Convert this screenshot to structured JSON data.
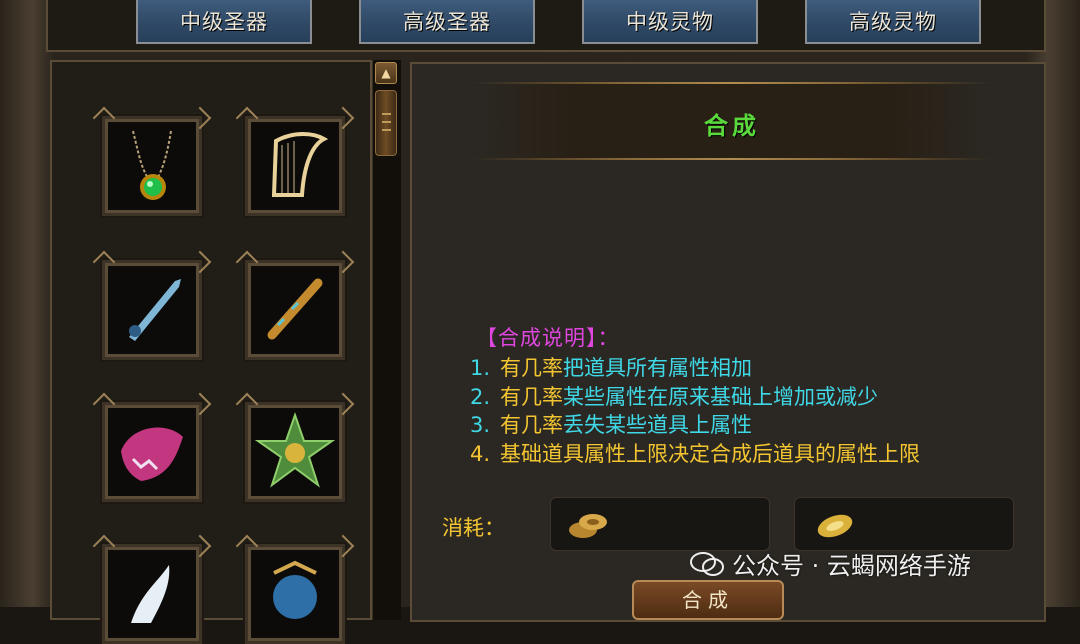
{
  "tabs": [
    {
      "label": "中级圣器"
    },
    {
      "label": "高级圣器"
    },
    {
      "label": "中级灵物"
    },
    {
      "label": "高级灵物"
    }
  ],
  "item_grid": {
    "items": [
      {
        "icon": "necklace-icon"
      },
      {
        "icon": "harp-icon"
      },
      {
        "icon": "sword-icon"
      },
      {
        "icon": "flute-icon"
      },
      {
        "icon": "beast-head-icon"
      },
      {
        "icon": "star-medal-icon"
      },
      {
        "icon": "spirit-icon"
      },
      {
        "icon": "crest-icon"
      }
    ]
  },
  "synthesis": {
    "title": "合成",
    "desc_header": "【合成说明】：",
    "rules": [
      {
        "num": "1.",
        "prefix": "有几率",
        "text": "把道具所有属性相加",
        "color": "#3fd8e6"
      },
      {
        "num": "2.",
        "prefix": "有几率",
        "text": "某些属性在原来基础上增加或减少",
        "color": "#3fd8e6"
      },
      {
        "num": "3.",
        "prefix": "有几率",
        "text": "丢失某些道具上属性",
        "color": "#3fd8e6"
      },
      {
        "num": "4.",
        "prefix": "",
        "text": "基础道具属性上限决定合成后道具的属性上限",
        "color": "#f3c531"
      }
    ],
    "cost_label": "消耗：",
    "cost_items": [
      {
        "icon": "gold-coins-icon"
      },
      {
        "icon": "gold-ingot-icon"
      }
    ],
    "merge_button": "合成"
  },
  "watermark": {
    "text": "公众号 · 云蝎网络手游",
    "icon": "wechat-icon"
  },
  "colors": {
    "title": "#59d93c",
    "header": "#de46de",
    "rule_cyan": "#3fd8e6",
    "rule_yellow": "#f3c531",
    "prefix": "#f3c531"
  }
}
